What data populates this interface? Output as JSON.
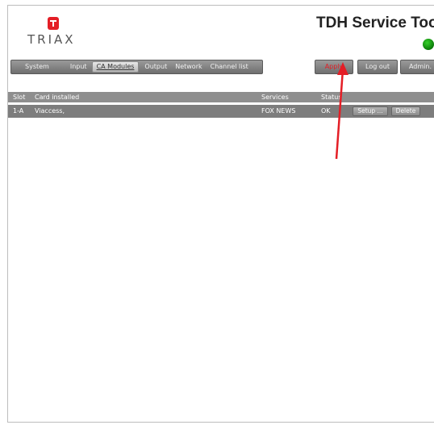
{
  "header": {
    "brand": "TRIAX",
    "app_title": "TDH Service Tool"
  },
  "tabs": [
    {
      "label": "System",
      "active": false
    },
    {
      "label": "Input",
      "active": false
    },
    {
      "label": "CA Modules",
      "active": true
    },
    {
      "label": "Output",
      "active": false
    },
    {
      "label": "Network",
      "active": false
    },
    {
      "label": "Channel list",
      "active": false
    }
  ],
  "actions": {
    "apply_label": "Apply",
    "logout_label": "Log out",
    "admin_label": "Admin."
  },
  "table": {
    "columns": [
      "Slot",
      "Card installed",
      "Services",
      "Status"
    ],
    "rows": [
      {
        "slot": "1-A",
        "card": "Viaccess,",
        "services": "FOX NEWS",
        "status": "OK",
        "setup_label": "Setup ...",
        "delete_label": "Delete"
      }
    ]
  },
  "colors": {
    "brand_red": "#e41e26",
    "status_green": "#1fb318",
    "annotation_arrow": "#e41e26"
  },
  "icons": {
    "logo": "triax-t-logo-icon",
    "status": "status-led-icon",
    "annotation": "red-arrow-icon"
  }
}
